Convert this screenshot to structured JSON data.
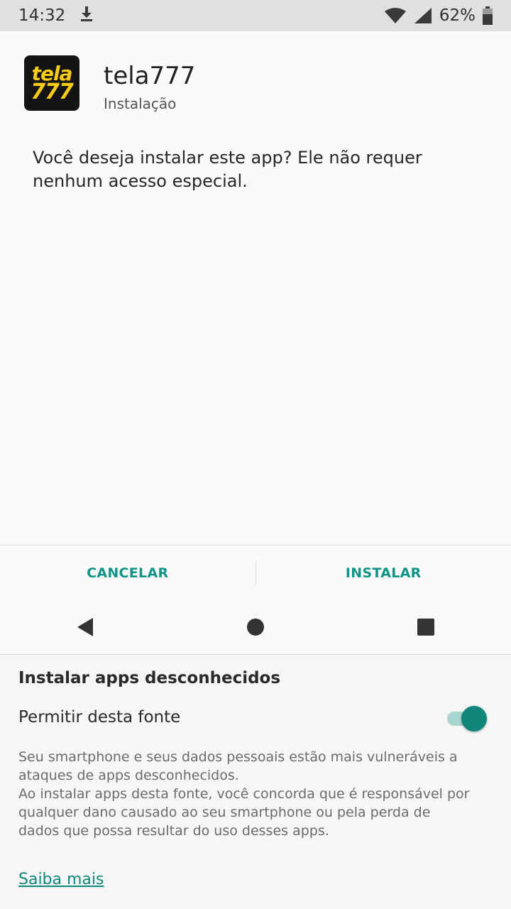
{
  "status_bar": {
    "time": "14:32",
    "battery": "62%",
    "icons": [
      "download-icon",
      "wifi-icon",
      "signal-icon",
      "battery-icon"
    ]
  },
  "app": {
    "icon_line1": "tela",
    "icon_line2": "777",
    "name": "tela777",
    "subtitle": "Instalação"
  },
  "dialog": {
    "question": "Você deseja instalar este app? Ele não requer nenhum acesso especial."
  },
  "actions": {
    "cancel_label": "CANCELAR",
    "install_label": "INSTALAR"
  },
  "nav": {
    "icons": [
      "back-icon",
      "home-icon",
      "recents-icon"
    ]
  },
  "unknown_apps": {
    "title": "Instalar apps desconhecidos",
    "toggle_label": "Permitir desta fonte",
    "toggle_on": true,
    "warning_line1": "Seu smartphone e seus dados pessoais estão mais vulneráveis a ataques de apps desconhecidos.",
    "warning_line2": "Ao instalar apps desta fonte, você concorda que é responsável por qualquer dano causado ao seu smartphone ou pela perda de dados que possa resultar do uso desses apps.",
    "learn_more": "Saiba mais"
  },
  "colors": {
    "accent": "#0f9488",
    "toggle_thumb": "#11877c",
    "toggle_track": "#a7d6d1",
    "app_icon_bg": "#141414",
    "app_icon_text": "#f7cb16"
  }
}
